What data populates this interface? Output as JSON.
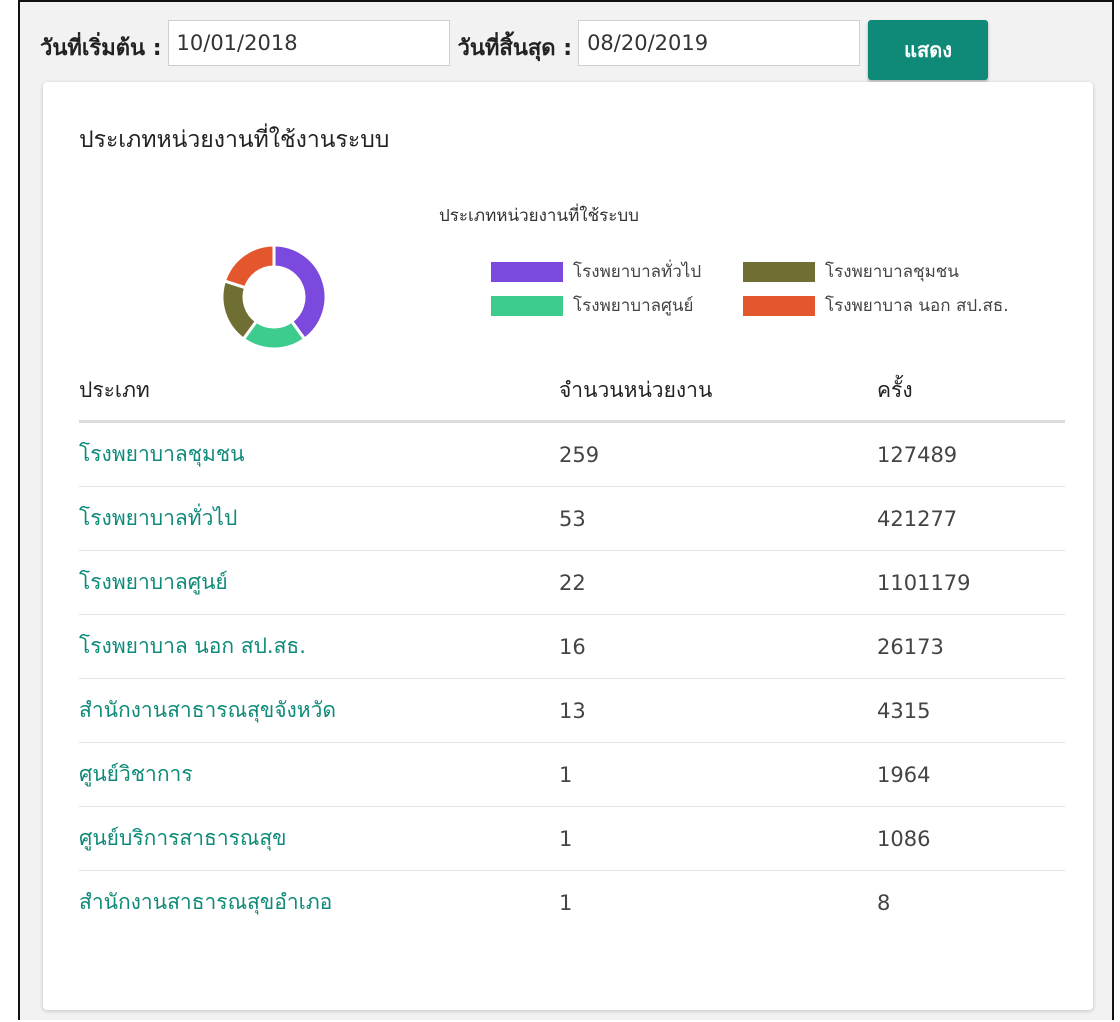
{
  "filters": {
    "start_label": "วันที่เริ่มต้น :",
    "start_value": "10/01/2018",
    "end_label": "วันที่สิ้นสุด :",
    "end_value": "08/20/2019",
    "show_button": "แสดง"
  },
  "card": {
    "title": "ประเภทหน่วยงานที่ใช้งานระบบ"
  },
  "chart_data": {
    "type": "pie",
    "title": "ประเภทหน่วยงานที่ใช้ระบบ",
    "style": "donut",
    "legend_position": "right",
    "categories": [
      "โรงพยาบาลทั่วไป",
      "โรงพยาบาลชุมชน",
      "โรงพยาบาลศูนย์",
      "โรงพยาบาล นอก สป.สธ."
    ],
    "colors": [
      "#7b49dd",
      "#6f6f33",
      "#3ecb8e",
      "#e4572e"
    ],
    "slice_order": [
      "โรงพยาบาลทั่วไป",
      "โรงพยาบาลศูนย์",
      "โรงพยาบาลชุมชน",
      "โรงพยาบาล นอก สป.สธ."
    ],
    "slice_values": [
      40,
      20,
      20,
      20
    ],
    "slice_colors": [
      "#7b49dd",
      "#3ecb8e",
      "#6f6f33",
      "#e4572e"
    ]
  },
  "table": {
    "headers": [
      "ประเภท",
      "จำนวนหน่วยงาน",
      "ครั้ง"
    ],
    "rows": [
      {
        "type": "โรงพยาบาลชุมชน",
        "units": "259",
        "times": "127489"
      },
      {
        "type": "โรงพยาบาลทั่วไป",
        "units": "53",
        "times": "421277"
      },
      {
        "type": "โรงพยาบาลศูนย์",
        "units": "22",
        "times": "1101179"
      },
      {
        "type": "โรงพยาบาล นอก สป.สธ.",
        "units": "16",
        "times": "26173"
      },
      {
        "type": "สำนักงานสาธารณสุขจังหวัด",
        "units": "13",
        "times": "4315"
      },
      {
        "type": "ศูนย์วิชาการ",
        "units": "1",
        "times": "1964"
      },
      {
        "type": "ศูนย์บริการสาธารณสุข",
        "units": "1",
        "times": "1086"
      },
      {
        "type": "สำนักงานสาธารณสุขอำเภอ",
        "units": "1",
        "times": "8"
      }
    ]
  }
}
